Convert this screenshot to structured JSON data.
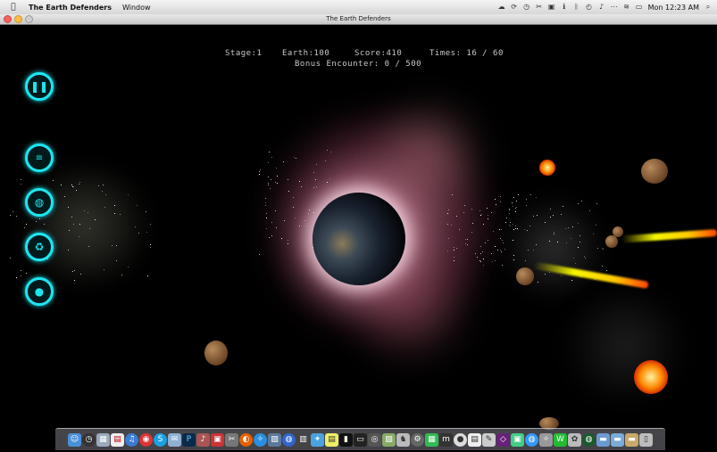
{
  "menubar": {
    "app_name": "The Earth Defenders",
    "menus": [
      "Window"
    ],
    "clock": "Mon 12:23 AM"
  },
  "window": {
    "title": "The Earth Defenders"
  },
  "hud": {
    "stage": "Stage:1",
    "earth": "Earth:100",
    "score": "Score:410",
    "times": "Times: 16 / 60",
    "bonus": "Bonus Encounter: 0 / 500"
  },
  "side_buttons": [
    {
      "name": "pause-button",
      "icon": "pause-icon"
    },
    {
      "name": "weapon-button-1",
      "icon": "missile-icon"
    },
    {
      "name": "weapon-button-2",
      "icon": "earth-shield-icon"
    },
    {
      "name": "weapon-button-3",
      "icon": "recycle-icon"
    },
    {
      "name": "weapon-button-4",
      "icon": "shield-icon"
    }
  ],
  "colors": {
    "hud_text": "#c9c9c9",
    "button_glow": "#1de6f0",
    "background": "#000000"
  }
}
